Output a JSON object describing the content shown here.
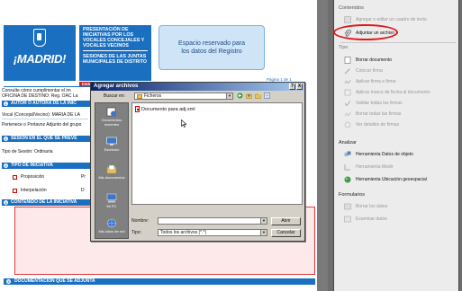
{
  "form": {
    "logo_text": "¡MADRID!",
    "subtitle_line1": "PRESENTACIÓN DE INICIATIVAS POR LOS VOCALES CONCEJALES Y VOCALES VECINOS",
    "subtitle_line2": "SESIONES DE LAS JUNTAS MUNICIPALES DE DISTRITO",
    "instructions_label": "Instrucciones",
    "registry_text": "Espacio reservado para los datos del Registro",
    "page_label": "Página 1 de 1",
    "consult_text": "Consulte cómo cumplimentar el im",
    "office_text": "OFICINA DE DESTINO:",
    "office_value": "Reg. OAC La",
    "section1_num": "1",
    "section1_title": "AUTOR O AUTORA DE LA INIC",
    "vocal_label": "Vocal (Concejal/Vecino):",
    "vocal_value": "MARIA DE LA",
    "group_text": "Pertenece o Portavoz Adjunto del grupo",
    "section2_num": "2",
    "section2_title": "SESIÓN EN EL QUE SE PREVÉ",
    "session_label": "Tipo de Sesión:",
    "session_value": "Ordinaria",
    "section3_num": "3",
    "section3_title": "TIPO DE INICIATIVA",
    "initiative_types": [
      "Proposición",
      "Interpelación"
    ],
    "initiative_col2": [
      "Pr",
      "D"
    ],
    "section4_num": "4",
    "section4_title": "CONTENIDO DE LA INICIATIVA",
    "section5_num": "5",
    "section5_title": "DOCUMENTACIÓN QUE SE ADJUNTA"
  },
  "dialog": {
    "title": "Agregar archivos",
    "help_button": "?",
    "close_button": "X",
    "look_in_label": "Buscar en:",
    "look_in_value": "Ficheros",
    "places": [
      "Documentos recientes",
      "Escritorio",
      "Mis documentos",
      "Mi PC",
      "Mis sitios de red"
    ],
    "files": [
      "Documento para adj.xml"
    ],
    "filename_label": "Nombre:",
    "filename_value": "",
    "filetype_label": "Tipo:",
    "filetype_value": "Todos los archivos (*.*)",
    "open_button": "Abrir",
    "cancel_button": "Cancelar"
  },
  "panel": {
    "top_label": "Contenidos",
    "tools_edit": [
      "Agregar o editar un cuadro de texto",
      "Adjuntar un archivo",
      "Tipo",
      "Borrar documento",
      "Colocar firma",
      "Aplicar firma a firma",
      "Aplicar marca de fecha al documento",
      "Validar todas las firmas",
      "Borrar todas las firmas",
      "Ver detalles de firmas"
    ],
    "analyze_heading": "Analizar",
    "tools_analyze": [
      "Herramienta Datos de objeto",
      "Herramienta Medir",
      "Herramienta Ubicación geoespacial"
    ],
    "forms_heading": "Formularios",
    "tools_forms": [
      "Borrar los datos",
      "Examinar datos"
    ]
  },
  "colors": {
    "brand_blue": "#1b6fc0",
    "alert_red": "#d12028",
    "highlight": "#e01818"
  },
  "icons": {
    "crest": "madrid-crest-icon",
    "paperclip": "paperclip-icon",
    "folder": "folder-icon",
    "document": "pdf-document-icon"
  }
}
